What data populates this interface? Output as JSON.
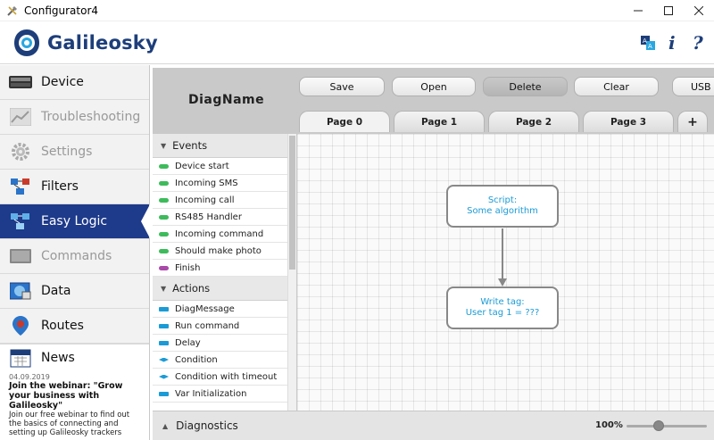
{
  "window": {
    "title": "Configurator4"
  },
  "header": {
    "brand": "Galileosky"
  },
  "sidebar": {
    "items": [
      {
        "label": "Device",
        "state": "normal"
      },
      {
        "label": "Troubleshooting",
        "state": "disabled"
      },
      {
        "label": "Settings",
        "state": "disabled"
      },
      {
        "label": "Filters",
        "state": "normal"
      },
      {
        "label": "Easy Logic",
        "state": "active"
      },
      {
        "label": "Commands",
        "state": "disabled"
      },
      {
        "label": "Data",
        "state": "normal"
      },
      {
        "label": "Routes",
        "state": "normal"
      }
    ],
    "news": {
      "label": "News",
      "date": "04.09.2019",
      "title": "Join the webinar: \"Grow your business with Galileosky\"",
      "body": "Join our free webinar to find out the basics of connecting and setting up Galileosky trackers"
    }
  },
  "editor": {
    "diag_name": "DiagName",
    "toolbar": {
      "save": "Save",
      "open": "Open",
      "delete": "Delete",
      "clear": "Clear",
      "usb": "USB"
    },
    "tabs": [
      "Page 0",
      "Page 1",
      "Page 2",
      "Page 3"
    ],
    "add_tab": "+",
    "palette": {
      "events_title": "Events",
      "events": [
        {
          "label": "Device start",
          "color": "#3dbb5b"
        },
        {
          "label": "Incoming SMS",
          "color": "#3dbb5b"
        },
        {
          "label": "Incoming call",
          "color": "#3dbb5b"
        },
        {
          "label": "RS485 Handler",
          "color": "#3dbb5b"
        },
        {
          "label": "Incoming command",
          "color": "#3dbb5b"
        },
        {
          "label": "Should make photo",
          "color": "#3dbb5b"
        },
        {
          "label": "Finish",
          "color": "#a94aa8"
        }
      ],
      "actions_title": "Actions",
      "actions": [
        {
          "label": "DiagMessage",
          "shape": "rect"
        },
        {
          "label": "Run command",
          "shape": "rect"
        },
        {
          "label": "Delay",
          "shape": "rect"
        },
        {
          "label": "Condition",
          "shape": "diamond"
        },
        {
          "label": "Condition with timeout",
          "shape": "diamond"
        },
        {
          "label": "Var Initialization",
          "shape": "rect"
        }
      ]
    },
    "nodes": [
      {
        "line1": "Script:",
        "line2": "Some algorithm"
      },
      {
        "line1": "Write tag:",
        "line2": "User tag 1 = ???"
      }
    ],
    "bottom": {
      "diagnostics": "Diagnostics",
      "zoom": "100%",
      "zoom_level": 0.4
    }
  }
}
